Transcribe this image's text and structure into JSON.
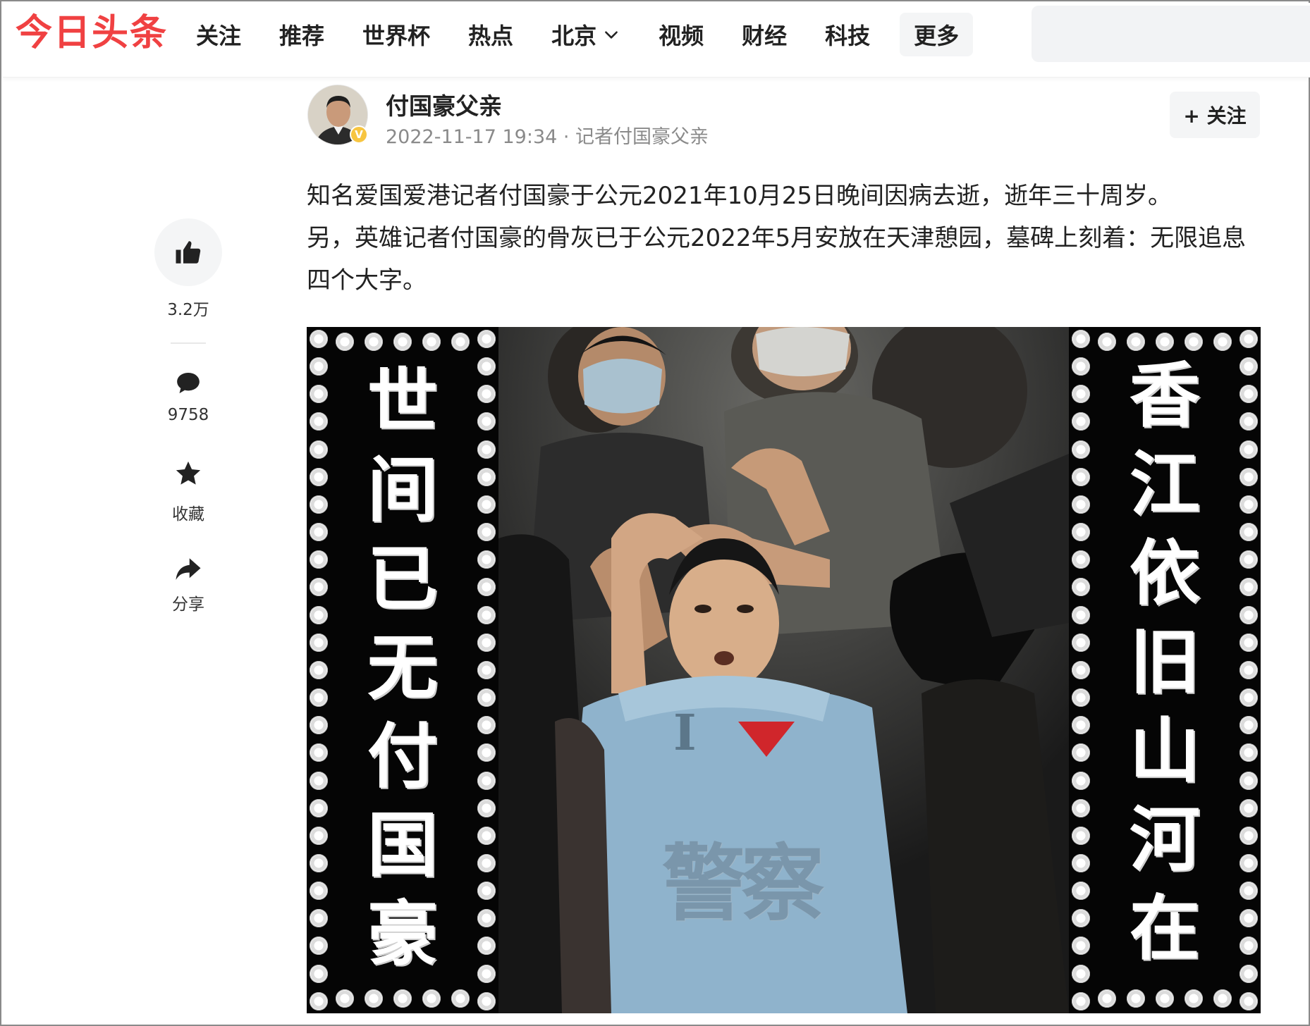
{
  "header": {
    "logo": "今日头条",
    "nav": [
      {
        "label": "关注"
      },
      {
        "label": "推荐"
      },
      {
        "label": "世界杯"
      },
      {
        "label": "热点"
      },
      {
        "label": "北京",
        "dropdown": true
      },
      {
        "label": "视频"
      },
      {
        "label": "财经"
      },
      {
        "label": "科技"
      },
      {
        "label": "更多"
      }
    ],
    "search_placeholder": ""
  },
  "author": {
    "name": "付国豪父亲",
    "datetime": "2022-11-17 19:34",
    "meta_suffix": " · 记者付国豪父亲",
    "verified_mark": "V",
    "follow_label": "+ 关注"
  },
  "actions": {
    "like_count": "3.2万",
    "comment_count": "9758",
    "favorite_label": "收藏",
    "share_label": "分享"
  },
  "article": {
    "paragraphs": [
      "知名爱国爱港记者付国豪于公元2021年10月25日晚间因病去逝，逝年三十周岁。",
      "另，英雄记者付国豪的骨灰已于公元2022年5月安放在天津憩园，墓碑上刻着：无限追息四个大字。"
    ]
  },
  "memorial_image": {
    "left_couplet": [
      "世",
      "间",
      "已",
      "无",
      "付",
      "国",
      "豪"
    ],
    "right_couplet": [
      "香",
      "江",
      "依",
      "旧",
      "山",
      "河",
      "在"
    ],
    "shirt_text": "警察"
  },
  "colors": {
    "brand": "#f04142",
    "text_primary": "#222222",
    "text_secondary": "#8a8a8a",
    "button_bg": "#f4f5f6",
    "verified": "#f7c541"
  }
}
